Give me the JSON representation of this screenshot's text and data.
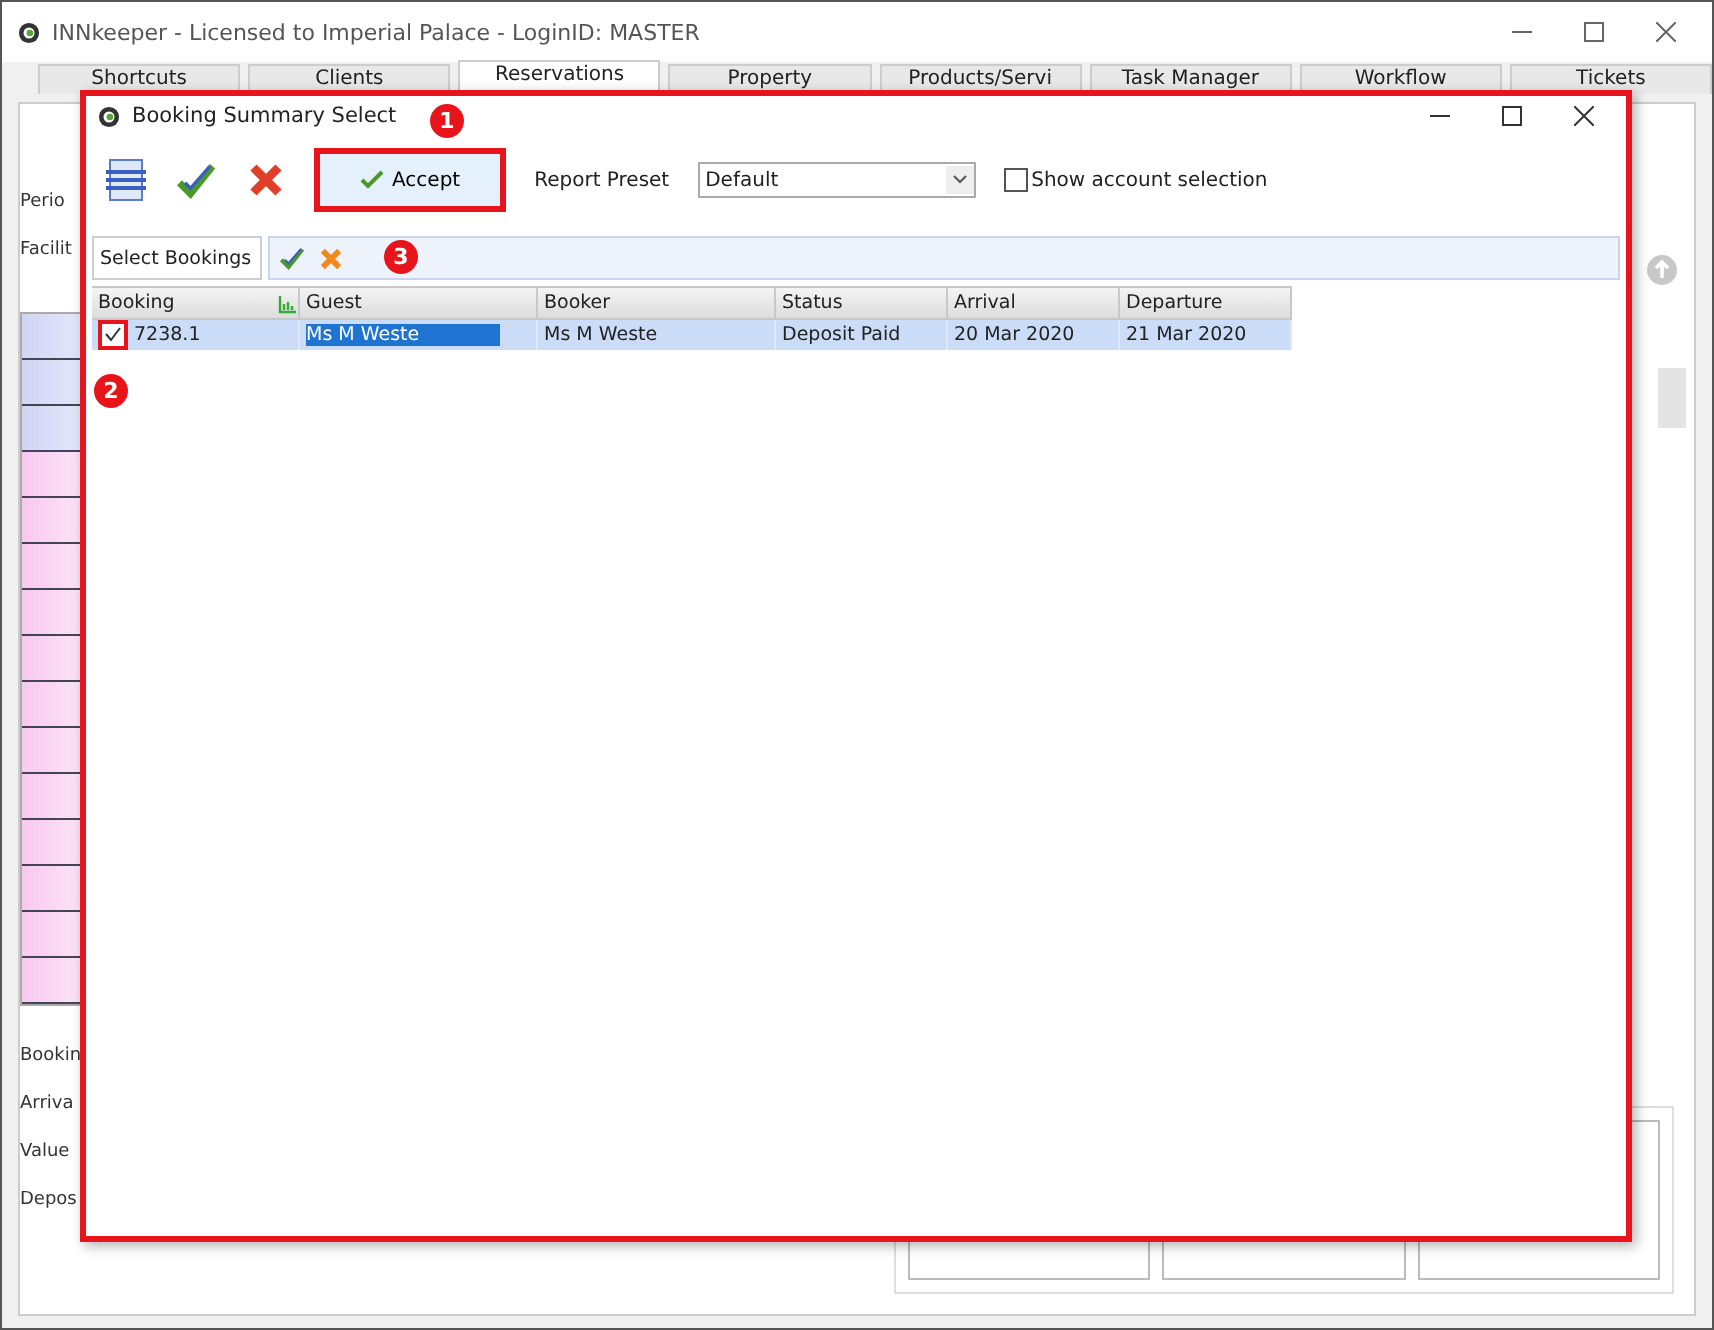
{
  "window": {
    "title": "INNkeeper - Licensed to Imperial Palace - LoginID: MASTER"
  },
  "tabs": [
    {
      "label": "Shortcuts",
      "selected": false
    },
    {
      "label": "Clients",
      "selected": false
    },
    {
      "label": "Reservations",
      "selected": true
    },
    {
      "label": "Property",
      "selected": false
    },
    {
      "label": "Products/Servi",
      "selected": false
    },
    {
      "label": "Task Manager",
      "selected": false
    },
    {
      "label": "Workflow",
      "selected": false
    },
    {
      "label": "Tickets",
      "selected": false
    }
  ],
  "background_labels": [
    "Perio",
    "Facilit",
    "Bookin",
    "Arriva",
    "Value",
    "Depos"
  ],
  "dialog": {
    "title": "Booking Summary Select",
    "toolbar": {
      "accept": {
        "label": "Accept",
        "highlighted": true,
        "callout": "1"
      },
      "preset_label": "Report Preset",
      "preset_value": "Default",
      "show_account": {
        "label": "Show account selection",
        "checked": false
      }
    },
    "select_bar": {
      "label": "Select Bookings",
      "callout": "3"
    },
    "table": {
      "columns": [
        "Booking",
        "Guest",
        "Booker",
        "Status",
        "Arrival",
        "Departure"
      ],
      "rows": [
        {
          "checked": true,
          "highlighted": true,
          "callout": "2",
          "selected": true,
          "cells": [
            "7238.1",
            "Ms M Weste",
            "Ms M Weste",
            "Deposit Paid",
            "20 Mar 2020",
            "21 Mar 2020"
          ]
        }
      ]
    }
  }
}
